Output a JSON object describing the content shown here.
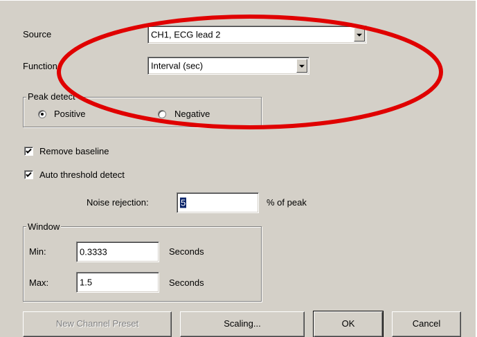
{
  "source": {
    "label": "Source",
    "value": "CH1, ECG lead 2"
  },
  "function": {
    "label": "Function",
    "value": "Interval (sec)"
  },
  "peak_detect": {
    "title": "Peak detect",
    "positive_label": "Positive",
    "negative_label": "Negative",
    "selected": "Positive"
  },
  "remove_baseline": {
    "label": "Remove baseline",
    "checked": true
  },
  "auto_threshold": {
    "label": "Auto threshold detect",
    "checked": true
  },
  "noise_rejection": {
    "label": "Noise rejection:",
    "value": "5",
    "unit": "% of peak"
  },
  "window": {
    "title": "Window",
    "min_label": "Min:",
    "min_value": "0.3333",
    "min_unit": "Seconds",
    "max_label": "Max:",
    "max_value": "1.5",
    "max_unit": "Seconds"
  },
  "buttons": {
    "new_channel_preset": "New Channel Preset",
    "scaling": "Scaling...",
    "ok": "OK",
    "cancel": "Cancel"
  },
  "annotation": {
    "color": "#e00000",
    "shape": "ellipse"
  },
  "colors": {
    "dialog_bg": "#d4d0c8",
    "selection": "#0a246a"
  }
}
